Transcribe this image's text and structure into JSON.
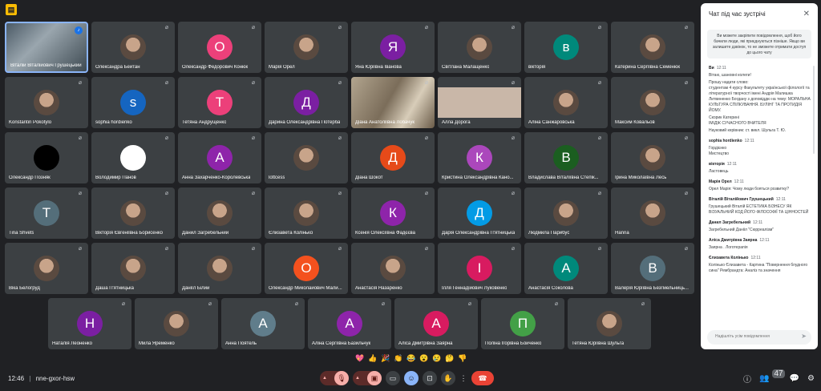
{
  "meeting": {
    "time": "12:46",
    "separator": "|",
    "code": "nne-gxor-hsw"
  },
  "tile_rows": [
    [
      {
        "name": "Віталій Віталійович Грушецький",
        "type": "video",
        "video": "v1",
        "speaking": true
      },
      {
        "name": "Олександра Бейтан",
        "type": "photo"
      },
      {
        "name": "Олександр Федорович Конюк",
        "type": "letter",
        "letter": "О",
        "color": "#ec407a"
      },
      {
        "name": "Марія Орел",
        "type": "photo"
      },
      {
        "name": "Яна Юріївна Іванова",
        "type": "letter",
        "letter": "Я",
        "color": "#7b1fa2"
      },
      {
        "name": "Світлана Малащенко",
        "type": "photo"
      },
      {
        "name": "вікторія",
        "type": "letter",
        "letter": "в",
        "color": "#00897b"
      },
      {
        "name": "Катерина Сергіївна Семенюк",
        "type": "photo"
      }
    ],
    [
      {
        "name": "Konstantin Pokotylo",
        "type": "photo"
      },
      {
        "name": "sophia hordienko",
        "type": "letter",
        "letter": "s",
        "color": "#1565c0"
      },
      {
        "name": "Тетяна Андрущенко",
        "type": "letter",
        "letter": "Т",
        "color": "#ec407a"
      },
      {
        "name": "Дарина Олександрівна Потерба",
        "type": "letter",
        "letter": "Д",
        "color": "#7b1fa2"
      },
      {
        "name": "Діана Анатоліївна Лобачук",
        "type": "video",
        "video": "v2"
      },
      {
        "name": "Алла Дорога",
        "type": "video",
        "video": "v3"
      },
      {
        "name": "Аліна Санжаровська",
        "type": "photo"
      },
      {
        "name": "Максим Ковальов",
        "type": "photo"
      }
    ],
    [
      {
        "name": "Олександр Позняк",
        "type": "letter",
        "letter": "",
        "color": "#000000"
      },
      {
        "name": "Володимир Панов",
        "type": "letter",
        "letter": "",
        "color": "#ffffff"
      },
      {
        "name": "Анна Захарченко-Королевська",
        "type": "letter",
        "letter": "А",
        "color": "#8e24aa"
      },
      {
        "name": "lottcess",
        "type": "photo"
      },
      {
        "name": "Діана Шокот",
        "type": "letter",
        "letter": "Д",
        "color": "#e64a19"
      },
      {
        "name": "Кристина Олександрівна Кано...",
        "type": "letter",
        "letter": "К",
        "color": "#ab47bc"
      },
      {
        "name": "Владислава Віталіївна Степік...",
        "type": "letter",
        "letter": "В",
        "color": "#1b5e20"
      },
      {
        "name": "Ірина Миколаївна Лесь",
        "type": "photo"
      }
    ],
    [
      {
        "name": "Tina Shvets",
        "type": "letter",
        "letter": "T",
        "color": "#546e7a"
      },
      {
        "name": "Вікторія Євгеніївна Борисенко",
        "type": "photo"
      },
      {
        "name": "Данил Загребельний",
        "type": "photo"
      },
      {
        "name": "Єлизавета Колінько",
        "type": "photo"
      },
      {
        "name": "Ксенія Олексіївна Фадєєва",
        "type": "letter",
        "letter": "К",
        "color": "#8e24aa"
      },
      {
        "name": "Дарія Олександрівна П'ятницька",
        "type": "letter",
        "letter": "Д",
        "color": "#039be5"
      },
      {
        "name": "Людмила Парибус",
        "type": "photo"
      },
      {
        "name": "Hanna",
        "type": "photo"
      }
    ],
    [
      {
        "name": "Віка Белогруд",
        "type": "photo"
      },
      {
        "name": "Даша П'ятницька",
        "type": "photo"
      },
      {
        "name": "Даніїл Білий",
        "type": "photo"
      },
      {
        "name": "Олександр Миколайович Мали...",
        "type": "letter",
        "letter": "О",
        "color": "#f4511e"
      },
      {
        "name": "Анастасія Назаренко",
        "type": "photo"
      },
      {
        "name": "Ілля Геннадійович Луковенко",
        "type": "letter",
        "letter": "І",
        "color": "#d81b60"
      },
      {
        "name": "Анастасія Соколова",
        "type": "letter",
        "letter": "А",
        "color": "#00897b"
      },
      {
        "name": "Валерія Юріївна Безгмельниць...",
        "type": "letter",
        "letter": "В",
        "color": "#546e7a"
      }
    ],
    [
      {
        "name": "Наталія Леоненко",
        "type": "letter",
        "letter": "Н",
        "color": "#7b1fa2"
      },
      {
        "name": "Мила Яременко",
        "type": "photo"
      },
      {
        "name": "Анна Поятель",
        "type": "letter",
        "letter": "А",
        "color": "#607d8b"
      },
      {
        "name": "Аліна Сергіївна Базильчук",
        "type": "letter",
        "letter": "А",
        "color": "#8e24aa"
      },
      {
        "name": "Аліса Дмитрівна Заярна",
        "type": "letter",
        "letter": "А",
        "color": "#d81b60"
      },
      {
        "name": "Поліна Ігорівна Бойченко",
        "type": "letter",
        "letter": "П",
        "color": "#43a047"
      },
      {
        "name": "Тетяна Юріївна Шульга",
        "type": "photo"
      }
    ]
  ],
  "reactions": [
    "💖",
    "👍",
    "🎉",
    "👏",
    "😂",
    "😮",
    "😢",
    "🤔",
    "👎"
  ],
  "chat": {
    "title": "Чат під час зустрічі",
    "notice": "Ви можете закріпити повідомлення, щоб його бачили люди, які приєднуються пізніше. Якщо ви залишите дзвінок, то не зможете отримати доступ до цього чату",
    "messages": [
      {
        "author": "Ви",
        "time": "12:11",
        "lines": [
          "Вітаю, шановні колеги!",
          "Прошу надати слово:\nстудентам 4 курсу Факультету української філології та літературної творчості імені Андрія Малишка\nЛитвиненко Богдану з доповіддю на тему: МОРАЛЬНА КУЛЬТУРА СПІЛКУВАННЯ. БУЛІНГ ТА ПРОТИДІЯ ЙОМУ.",
          "Скорик Катерині\nІМІДЖ СУЧАСНОГО ВЧИТЕЛЯ",
          "Науковий керівник: ст. викл. Шульга Т. Ю."
        ]
      },
      {
        "author": "sophia hordienko",
        "time": "12:11",
        "lines": [
          "Гордієнко\nМистецтво"
        ]
      },
      {
        "author": "вікторія",
        "time": "12:11",
        "lines": [
          "Ластовець"
        ]
      },
      {
        "author": "Марія Орел",
        "time": "12:11",
        "lines": [
          "Орел Марія: Чому люди бояться розвитку?"
        ]
      },
      {
        "author": "Віталій Віталійович Грушецький",
        "time": "12:11",
        "lines": [
          "Грушецький Віталій ЕСТЕТИКА БІЗНЕСУ ЯК ВІЗУАЛЬНИЙ КОД ЙОГО ФІЛОСОФІЇ ТА ЦІННОСТЕЙ"
        ]
      },
      {
        "author": "Данил Загребельний",
        "time": "12:11",
        "lines": [
          "Загребельний Данііл \"Сюрреалізм\""
        ]
      },
      {
        "author": "Аліса Дмитрівна Заярна",
        "time": "12:11",
        "lines": [
          "Заярна . Логотерапія"
        ]
      },
      {
        "author": "Єлизавета Колінько",
        "time": "12:11",
        "lines": [
          "Колінько Єлизавета - Картина \"Повернення блудного сина\" Рембрандта: Аналіз та значення"
        ]
      }
    ],
    "input_placeholder": "Надішліть усім повідомлення"
  },
  "participants_count": "47"
}
